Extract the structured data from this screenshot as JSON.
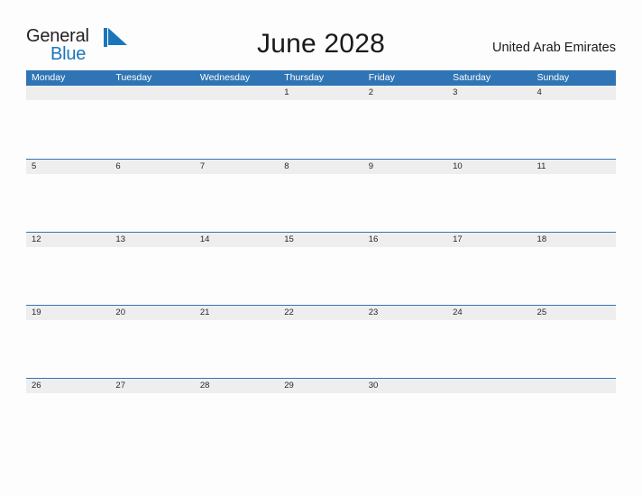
{
  "logo": {
    "word1": "General",
    "word2": "Blue",
    "flag_icon": "blue-flag-icon",
    "color_dark": "#231f20",
    "color_blue": "#1b75bb"
  },
  "header": {
    "title": "June 2028",
    "region": "United Arab Emirates"
  },
  "theme": {
    "header_blue": "#2f75b5",
    "band_gray": "#eeeeee",
    "page_bg": "#fdfdfd",
    "text_dark": "#262626"
  },
  "calendar": {
    "month": "June",
    "year": "2028",
    "weekday_headers": [
      "Monday",
      "Tuesday",
      "Wednesday",
      "Thursday",
      "Friday",
      "Saturday",
      "Sunday"
    ],
    "weeks": [
      {
        "days": [
          "",
          "",
          "",
          "1",
          "2",
          "3",
          "4"
        ]
      },
      {
        "days": [
          "5",
          "6",
          "7",
          "8",
          "9",
          "10",
          "11"
        ]
      },
      {
        "days": [
          "12",
          "13",
          "14",
          "15",
          "16",
          "17",
          "18"
        ]
      },
      {
        "days": [
          "19",
          "20",
          "21",
          "22",
          "23",
          "24",
          "25"
        ]
      },
      {
        "days": [
          "26",
          "27",
          "28",
          "29",
          "30",
          "",
          ""
        ]
      }
    ]
  }
}
